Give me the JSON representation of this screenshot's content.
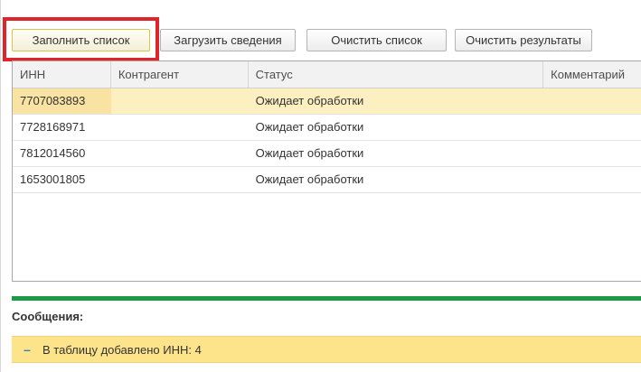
{
  "toolbar": {
    "fill_list": "Заполнить список",
    "load_info": "Загрузить сведения",
    "clear_list": "Очистить список",
    "clear_results": "Очистить результаты"
  },
  "table": {
    "columns": [
      "ИНН",
      "Контрагент",
      "Статус",
      "Комментарий"
    ],
    "rows": [
      {
        "inn": "7707083893",
        "counterparty": "",
        "status": "Ожидает обработки",
        "comment": ""
      },
      {
        "inn": "7728168971",
        "counterparty": "",
        "status": "Ожидает обработки",
        "comment": ""
      },
      {
        "inn": "7812014560",
        "counterparty": "",
        "status": "Ожидает обработки",
        "comment": ""
      },
      {
        "inn": "1653001805",
        "counterparty": "",
        "status": "Ожидает обработки",
        "comment": ""
      }
    ]
  },
  "messages": {
    "title": "Сообщения:",
    "items": [
      {
        "icon": "collapse-dash-icon",
        "text": "В таблицу добавлено ИНН: 4"
      }
    ]
  },
  "colors": {
    "highlight_frame": "#e0252a",
    "selected_row": "#fcf0c0",
    "separator": "#1e9a46",
    "message_bar": "#fde48a"
  }
}
